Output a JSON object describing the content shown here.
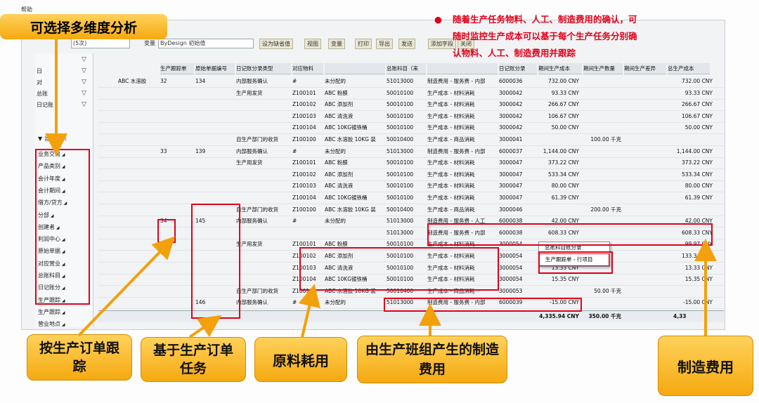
{
  "menubar": {
    "help": "帮助"
  },
  "annotation": {
    "title": "可选择多维度分析",
    "note": [
      "随着生产任务物料、人工、制造费用的确认，可",
      "随时监控生产成本可以基于每个生产任务分别确",
      "认物料、人工、制造费用并跟踪"
    ],
    "callouts": [
      "按生产订单跟踪",
      "基于生产订单任务",
      "原料耗用",
      "由生产班组产生的制造费用",
      "制造费用"
    ]
  },
  "toolbar": {
    "variant_label": "变量",
    "variant_value": "ByDesign 初始值",
    "btn_default": "设为缺省值",
    "btn_view": "视图",
    "btn_variable": "变量",
    "btn_print": "打印",
    "btn_export": "导出",
    "btn_send": "发送",
    "btn_add_field": "添加字段",
    "btn_close": "关闭",
    "left_select": "(5次)"
  },
  "leftpanel": {
    "section": "当前显示",
    "top_items": [
      "",
      "日",
      "对",
      "总账",
      "日记账"
    ],
    "dimensions": [
      "业务交易",
      "产品类别",
      "会计年度",
      "会计期间",
      "借方/贷方",
      "分部",
      "创建者",
      "利润中心",
      "原始单据",
      "对应营业",
      "总账科目",
      "日记账分",
      "生产跟踪",
      "生产跟踪",
      "营业地点"
    ]
  },
  "grid": {
    "headers": [
      "生产跟踪单",
      "原始单据编号",
      "日记账分录类型",
      "对应物料",
      "",
      "总账科目（来",
      "",
      "日记账分录",
      "期间生产成本",
      "期间生产数量",
      "期间生产差异",
      "总生产成本"
    ],
    "rows": [
      {
        "prod": "ABC 水溶胶",
        "track": "32",
        "doc": "134",
        "type": "内部服务确认",
        "mat": "#",
        "matdesc": "未分配的",
        "gl": "51013000",
        "gldesc": "制造费用 - 服务费 - 内部",
        "je": "6000036",
        "cost": "732.00 CNY",
        "qty": "",
        "diff": "",
        "total": "732.00 CNY"
      },
      {
        "prod": "",
        "track": "",
        "doc": "",
        "type": "生产用发货",
        "mat": "Z100101",
        "matdesc": "ABC 粉膜",
        "gl": "50010100",
        "gldesc": "生产成本 - 材料消耗",
        "je": "3000042",
        "cost": "93.33 CNY",
        "qty": "",
        "diff": "",
        "total": "93.33 CNY"
      },
      {
        "prod": "",
        "track": "",
        "doc": "",
        "type": "",
        "mat": "Z100102",
        "matdesc": "ABC 添加剂",
        "gl": "50010100",
        "gldesc": "生产成本 - 材料消耗",
        "je": "3000042",
        "cost": "266.67 CNY",
        "qty": "",
        "diff": "",
        "total": "266.67 CNY"
      },
      {
        "prod": "",
        "track": "",
        "doc": "",
        "type": "",
        "mat": "Z100103",
        "matdesc": "ABC 清洗液",
        "gl": "50010100",
        "gldesc": "生产成本 - 材料消耗",
        "je": "3000042",
        "cost": "106.67 CNY",
        "qty": "",
        "diff": "",
        "total": "106.67 CNY"
      },
      {
        "prod": "",
        "track": "",
        "doc": "",
        "type": "",
        "mat": "Z100104",
        "matdesc": "ABC 10KG镀铁桶",
        "gl": "50010100",
        "gldesc": "生产成本 - 材料消耗",
        "je": "3000042",
        "cost": "50.00 CNY",
        "qty": "",
        "diff": "",
        "total": "50.00 CNY"
      },
      {
        "prod": "",
        "track": "",
        "doc": "",
        "type": "自生产部门的收货",
        "mat": "Z100100",
        "matdesc": "ABC 水溶胶 10KG 装",
        "gl": "50010400",
        "gldesc": "生产成本 - 商品消耗",
        "je": "3000041",
        "cost": "",
        "qty": "100.00 千克",
        "diff": "",
        "total": ""
      },
      {
        "prod": "",
        "track": "33",
        "doc": "139",
        "type": "内部服务确认",
        "mat": "#",
        "matdesc": "未分配的",
        "gl": "51013000",
        "gldesc": "制造费用 - 服务费 - 内部",
        "je": "6000037",
        "cost": "1,144.00 CNY",
        "qty": "",
        "diff": "",
        "total": "1,144.00 CNY"
      },
      {
        "prod": "",
        "track": "",
        "doc": "",
        "type": "生产用发货",
        "mat": "Z100101",
        "matdesc": "ABC 粉膜",
        "gl": "50010100",
        "gldesc": "生产成本 - 材料消耗",
        "je": "3000047",
        "cost": "373.22 CNY",
        "qty": "",
        "diff": "",
        "total": "373.22 CNY"
      },
      {
        "prod": "",
        "track": "",
        "doc": "",
        "type": "",
        "mat": "Z100102",
        "matdesc": "ABC 添加剂",
        "gl": "50010100",
        "gldesc": "生产成本 - 材料消耗",
        "je": "3000047",
        "cost": "533.34 CNY",
        "qty": "",
        "diff": "",
        "total": "533.34 CNY"
      },
      {
        "prod": "",
        "track": "",
        "doc": "",
        "type": "",
        "mat": "Z100103",
        "matdesc": "ABC 清洗液",
        "gl": "50010100",
        "gldesc": "生产成本 - 材料消耗",
        "je": "3000047",
        "cost": "80.00 CNY",
        "qty": "",
        "diff": "",
        "total": "80.00 CNY"
      },
      {
        "prod": "",
        "track": "",
        "doc": "",
        "type": "",
        "mat": "Z100104",
        "matdesc": "ABC 10KG镀铁桶",
        "gl": "50010100",
        "gldesc": "生产成本 - 材料消耗",
        "je": "3000047",
        "cost": "61.39 CNY",
        "qty": "",
        "diff": "",
        "total": "61.39 CNY"
      },
      {
        "prod": "",
        "track": "",
        "doc": "",
        "type": "自生产部门的收货",
        "mat": "Z100100",
        "matdesc": "ABC 水溶胶 10KG 装",
        "gl": "50010400",
        "gldesc": "生产成本 - 商品消耗",
        "je": "3000046",
        "cost": "",
        "qty": "200.00 千克",
        "diff": "",
        "total": ""
      },
      {
        "prod": "",
        "track": "34",
        "doc": "145",
        "type": "内部服务确认",
        "mat": "#",
        "matdesc": "未分配的",
        "gl": "51013000",
        "gldesc": "制造费用 - 服务费 - 人工",
        "je": "6000038",
        "cost": "42.00 CNY",
        "qty": "",
        "diff": "",
        "total": "42.00 CNY"
      },
      {
        "prod": "",
        "track": "",
        "doc": "",
        "type": "",
        "mat": "",
        "matdesc": "",
        "gl": "51013000",
        "gldesc": "制造费用 - 服务费 - 内部",
        "je": "6000038",
        "cost": "608.33 CNY",
        "qty": "",
        "diff": "",
        "total": "608.33 CNY"
      },
      {
        "prod": "",
        "track": "",
        "doc": "",
        "type": "生产用发货",
        "mat": "Z100101",
        "matdesc": "ABC 粉膜",
        "gl": "50010100",
        "gldesc": "生产成本 - 材料消耗",
        "je": "3000054",
        "cost": "99.97 CNY",
        "qty": "",
        "diff": "",
        "total": "99.97 CNY"
      },
      {
        "prod": "",
        "track": "",
        "doc": "",
        "type": "",
        "mat": "Z100102",
        "matdesc": "ABC 添加剂",
        "gl": "50010100",
        "gldesc": "生产成本 - 材料消耗",
        "je": "3000054",
        "cost": "133.34 CNY",
        "qty": "",
        "diff": "",
        "total": "133.34 CNY"
      },
      {
        "prod": "",
        "track": "",
        "doc": "",
        "type": "",
        "mat": "Z100103",
        "matdesc": "ABC 清洗液",
        "gl": "50010100",
        "gldesc": "生产成本 - 材料消耗",
        "je": "3000054",
        "cost": "13.33 CNY",
        "qty": "",
        "diff": "",
        "total": "13.33 CNY"
      },
      {
        "prod": "",
        "track": "",
        "doc": "",
        "type": "",
        "mat": "Z100104",
        "matdesc": "ABC 10KG镀铁桶",
        "gl": "50010100",
        "gldesc": "生产成本 - 材料消耗",
        "je": "3000054",
        "cost": "15.35 CNY",
        "qty": "",
        "diff": "",
        "total": "15.35 CNY"
      },
      {
        "prod": "",
        "track": "",
        "doc": "",
        "type": "自生产部门的收货",
        "mat": "Z100100",
        "matdesc": "ABC 水溶胶 10KG 装",
        "gl": "50010400",
        "gldesc": "生产成本 - 商品消耗",
        "je": "3000053",
        "cost": "",
        "qty": "50.00 千克",
        "diff": "",
        "total": ""
      },
      {
        "prod": "",
        "track": "",
        "doc": "146",
        "type": "内部服务确认",
        "mat": "#",
        "matdesc": "未分配的",
        "gl": "51013000",
        "gldesc": "制造费用 - 服务费 - 内部",
        "je": "6000039",
        "cost": "-15.00 CNY",
        "qty": "",
        "diff": "",
        "total": "-15.00 CNY"
      }
    ],
    "total": {
      "cost": "4,335.94 CNY",
      "qty": "350.00 千克",
      "total": "4,33"
    }
  },
  "popup": [
    "总账科目账分录",
    "生产跟踪单 - 行项目"
  ]
}
